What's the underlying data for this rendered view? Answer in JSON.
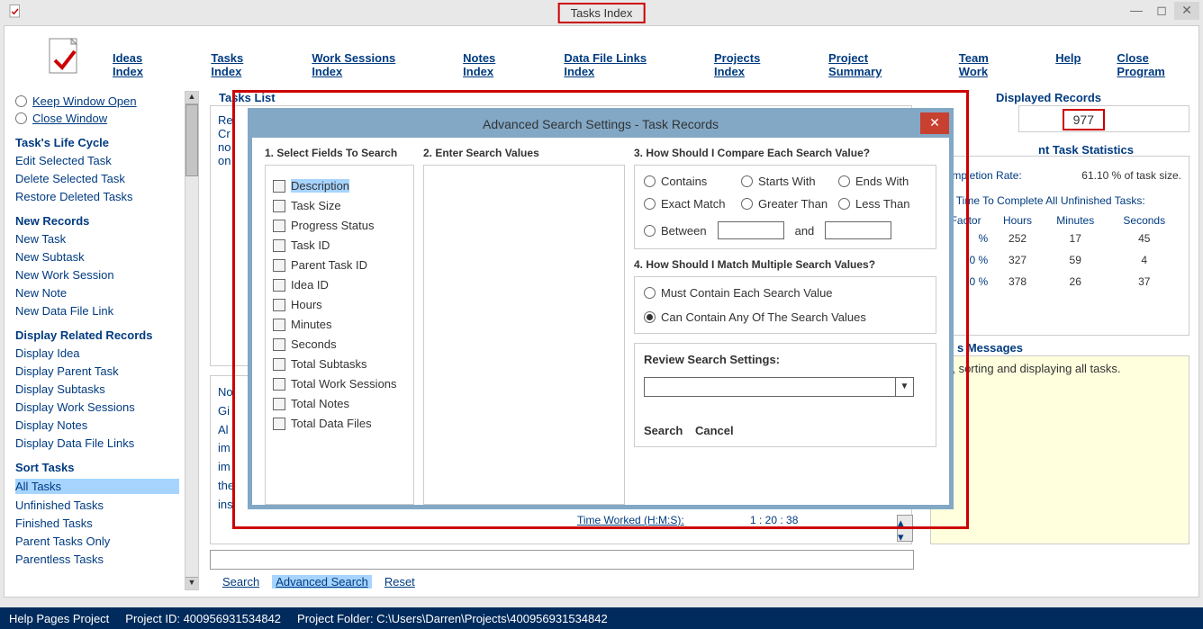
{
  "window_title": "Tasks Index",
  "menu": [
    "Ideas Index",
    "Tasks Index",
    "Work Sessions Index",
    "Notes Index",
    "Data File Links Index",
    "Projects Index",
    "Project Summary",
    "Team Work",
    "Help",
    "Close Program"
  ],
  "left": {
    "keep_open": "Keep Window Open",
    "close_window": "Close Window",
    "life_cycle_head": "Task's Life Cycle",
    "life_cycle": [
      "Edit Selected Task",
      "Delete Selected Task",
      "Restore Deleted Tasks"
    ],
    "new_records_head": "New Records",
    "new_records": [
      "New Task",
      "New Subtask",
      "New Work Session",
      "New Note",
      "New Data File Link"
    ],
    "related_head": "Display Related Records",
    "related": [
      "Display Idea",
      "Display Parent Task",
      "Display Subtasks",
      "Display Work Sessions",
      "Display Notes",
      "Display Data File Links"
    ],
    "sort_head": "Sort Tasks",
    "sort_items": [
      "All Tasks",
      "Unfinished Tasks",
      "Finished Tasks",
      "Parent Tasks Only",
      "Parentless Tasks"
    ],
    "sort_selected_index": 0
  },
  "tasks_list_label": "Tasks List",
  "list1_text": "Re\nCr\nno\non",
  "list2_text": "No\nGi\nAl\nim\nim\nthe\nins",
  "displayed_records_label": "Displayed Records",
  "displayed_records_value": "977",
  "stats_head": "nt Task Statistics",
  "stats": {
    "completion_label": "Completion Rate:",
    "completion_value": "61.10 % of task size.",
    "estimated_label": "ted Time To Complete All Unfinished Tasks:",
    "cols": [
      "Factor",
      "Hours",
      "Minutes",
      "Seconds"
    ],
    "rows": [
      {
        "f": "%",
        "h": "252",
        "m": "17",
        "s": "45"
      },
      {
        "f": "0 %",
        "h": "327",
        "m": "59",
        "s": "4"
      },
      {
        "f": "0 %",
        "h": "378",
        "m": "26",
        "s": "37"
      }
    ]
  },
  "messages_head": "s Messages",
  "messages_text": "ing, sorting and displaying all tasks.",
  "time_worked_label": "Time Worked (H:M:S):",
  "time_worked_value": "1 : 20 : 38",
  "search_links": [
    "Search",
    "Advanced Search",
    "Reset"
  ],
  "search_selected_index": 1,
  "statusbar": {
    "help": "Help Pages Project",
    "project_id": "Project ID:  400956931534842",
    "project_folder": "Project Folder: C:\\Users\\Darren\\Projects\\400956931534842"
  },
  "dialog": {
    "title": "Advanced Search Settings - Task Records",
    "step1": "1. Select Fields To Search",
    "fields": [
      "Description",
      "Task Size",
      "Progress Status",
      "Task ID",
      "Parent Task ID",
      "Idea ID",
      "Hours",
      "Minutes",
      "Seconds",
      "Total Subtasks",
      "Total Work Sessions",
      "Total Notes",
      "Total Data Files"
    ],
    "highlighted_field": 0,
    "step2": "2. Enter Search Values",
    "step3": "3. How Should I Compare Each Search Value?",
    "compare": [
      "Contains",
      "Starts With",
      "Ends With",
      "Exact Match",
      "Greater Than",
      "Less Than"
    ],
    "between_label": "Between",
    "and_label": "and",
    "step4": "4. How Should I Match Multiple Search Values?",
    "match_options": [
      "Must Contain Each Search Value",
      "Can Contain Any Of The Search Values"
    ],
    "match_selected": 1,
    "review_label": "Review Search Settings:",
    "btn_search": "Search",
    "btn_cancel": "Cancel"
  }
}
